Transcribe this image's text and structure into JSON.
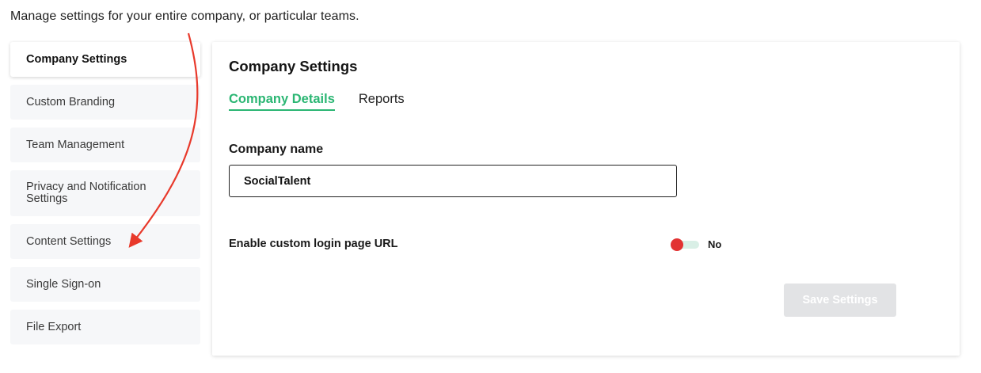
{
  "intro": {
    "text": "Manage settings for your entire company, or particular teams."
  },
  "sidebar": {
    "items": [
      {
        "label": "Company Settings",
        "active": true
      },
      {
        "label": "Custom Branding",
        "active": false
      },
      {
        "label": "Team Management",
        "active": false
      },
      {
        "label": "Privacy and Notification Settings",
        "active": false
      },
      {
        "label": "Content Settings",
        "active": false
      },
      {
        "label": "Single Sign-on",
        "active": false
      },
      {
        "label": "File Export",
        "active": false
      }
    ]
  },
  "main": {
    "title": "Company Settings",
    "tabs": [
      {
        "label": "Company Details",
        "active": true
      },
      {
        "label": "Reports",
        "active": false
      }
    ],
    "company_name": {
      "label": "Company name",
      "value": "SocialTalent",
      "placeholder": ""
    },
    "custom_login": {
      "label": "Enable custom login page URL",
      "enabled": false,
      "state_text": "No"
    },
    "save_button": {
      "label": "Save Settings",
      "disabled": true
    }
  },
  "colors": {
    "accent_green": "#2bb673",
    "toggle_off_red": "#e23232",
    "annotation_arrow_red": "#e8392b",
    "disabled_button": "#e2e3e5"
  },
  "annotations": {
    "arrow": "red arrow pointing from top toward Content Settings"
  }
}
